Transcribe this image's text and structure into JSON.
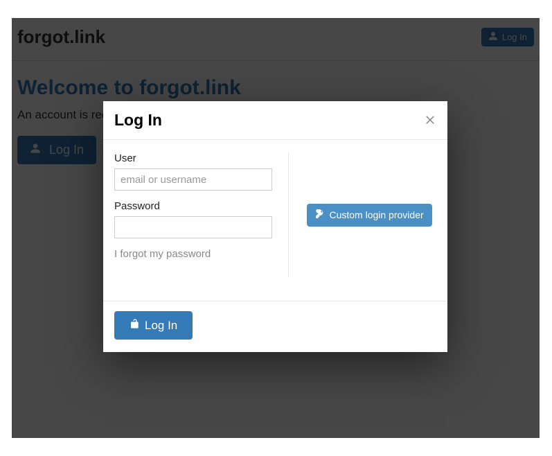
{
  "header": {
    "brand": "forgot.link",
    "login_label": "Log In"
  },
  "main": {
    "welcome_title": "Welcome to forgot.link",
    "subtext": "An account is required. Please log in.",
    "login_button_label": "Log In"
  },
  "modal": {
    "title": "Log In",
    "user_label": "User",
    "user_placeholder": "email or username",
    "password_label": "Password",
    "forgot_password": "I forgot my password",
    "custom_provider_label": "Custom login provider",
    "submit_label": "Log In"
  }
}
